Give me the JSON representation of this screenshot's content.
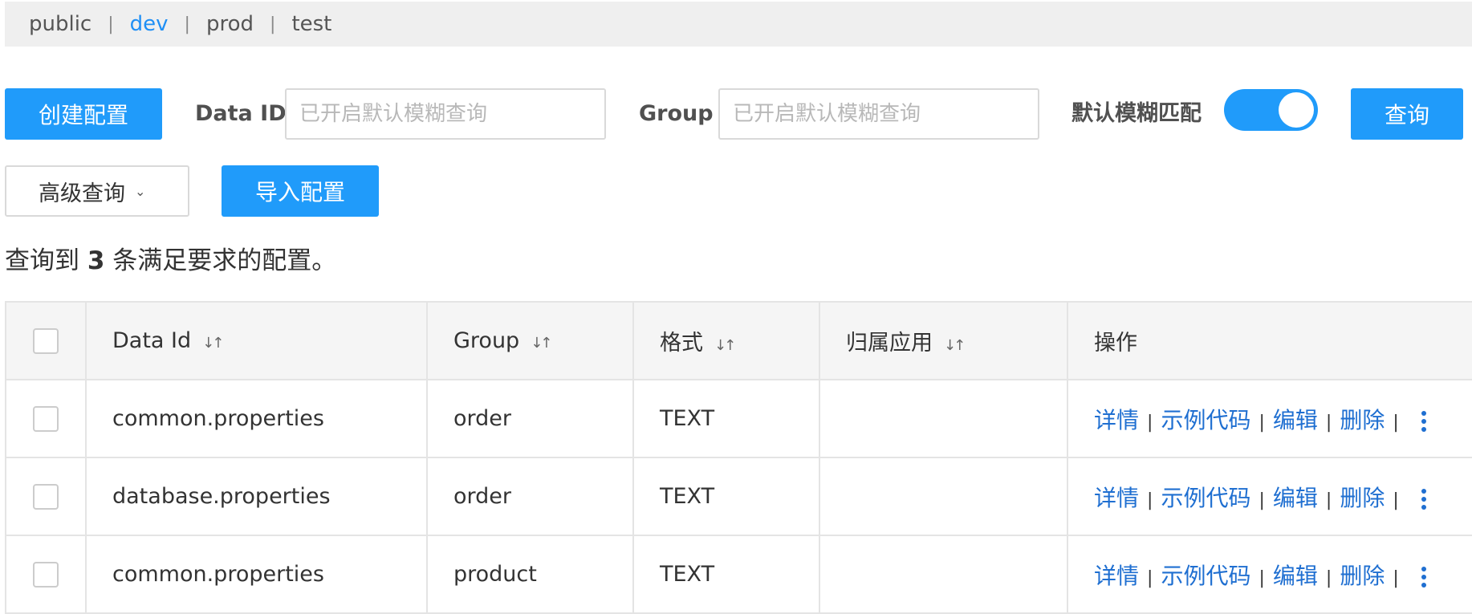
{
  "namespaces": {
    "items": [
      "public",
      "dev",
      "prod",
      "test"
    ],
    "active": "dev"
  },
  "toolbar": {
    "create_label": "创建配置",
    "dataid_label": "Data ID",
    "dataid_placeholder": "已开启默认模糊查询",
    "group_label": "Group",
    "group_placeholder": "已开启默认模糊查询",
    "fuzzy_label": "默认模糊匹配",
    "fuzzy_enabled": true,
    "search_label": "查询",
    "advanced_label": "高级查询",
    "import_label": "导入配置"
  },
  "summary": {
    "prefix": "查询到 ",
    "count": "3",
    "suffix": " 条满足要求的配置。"
  },
  "table": {
    "columns": [
      "Data Id",
      "Group",
      "格式",
      "归属应用",
      "操作"
    ],
    "rows": [
      {
        "data_id": "common.properties",
        "group": "order",
        "format": "TEXT",
        "app": ""
      },
      {
        "data_id": "database.properties",
        "group": "order",
        "format": "TEXT",
        "app": ""
      },
      {
        "data_id": "common.properties",
        "group": "product",
        "format": "TEXT",
        "app": ""
      }
    ],
    "actions": [
      "详情",
      "示例代码",
      "编辑",
      "删除"
    ],
    "action_sep": "|"
  },
  "colors": {
    "primary": "#209bfa",
    "link": "#1f6fd1",
    "active_ns": "#1f8ff5"
  }
}
